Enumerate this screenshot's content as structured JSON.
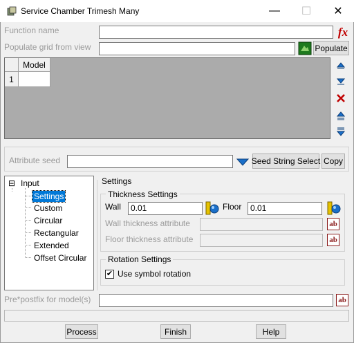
{
  "window": {
    "title": "Service Chamber Trimesh Many",
    "minimize": "—",
    "maximize": "☐",
    "close": "✕"
  },
  "function_name": {
    "label": "Function name",
    "value": ""
  },
  "populate": {
    "label": "Populate grid from view",
    "value": "",
    "button": "Populate"
  },
  "grid": {
    "column_header": "Model",
    "rows": [
      {
        "num": "1",
        "model": ""
      }
    ]
  },
  "attribute_seed": {
    "label": "Attribute seed",
    "value": "",
    "seed_button": "Seed String Select",
    "copy_button": "Copy"
  },
  "tree": {
    "root": "Input",
    "expander": "⊟",
    "items": [
      "Settings",
      "Custom",
      "Circular",
      "Rectangular",
      "Extended",
      "Offset Circular"
    ],
    "selected": "Settings"
  },
  "settings": {
    "group_title": "Settings",
    "thickness": {
      "title": "Thickness Settings",
      "wall_label": "Wall",
      "wall_value": "0.01",
      "floor_label": "Floor",
      "floor_value": "0.01",
      "wall_attr_label": "Wall thickness attribute",
      "wall_attr_value": "",
      "floor_attr_label": "Floor thickness attribute",
      "floor_attr_value": ""
    },
    "rotation": {
      "title": "Rotation Settings",
      "use_symbol_label": "Use symbol rotation",
      "use_symbol_checked": true,
      "check_mark": "✔"
    }
  },
  "prefix": {
    "label": "Pre*postfix for model(s)",
    "value": ""
  },
  "status": "",
  "buttons": {
    "process": "Process",
    "finish": "Finish",
    "help": "Help"
  },
  "icons": {
    "fx": "fx",
    "ab": "ab",
    "colors": {
      "red": "#c00000",
      "blue": "#1a6fc9",
      "selection": "#0078d7"
    }
  }
}
